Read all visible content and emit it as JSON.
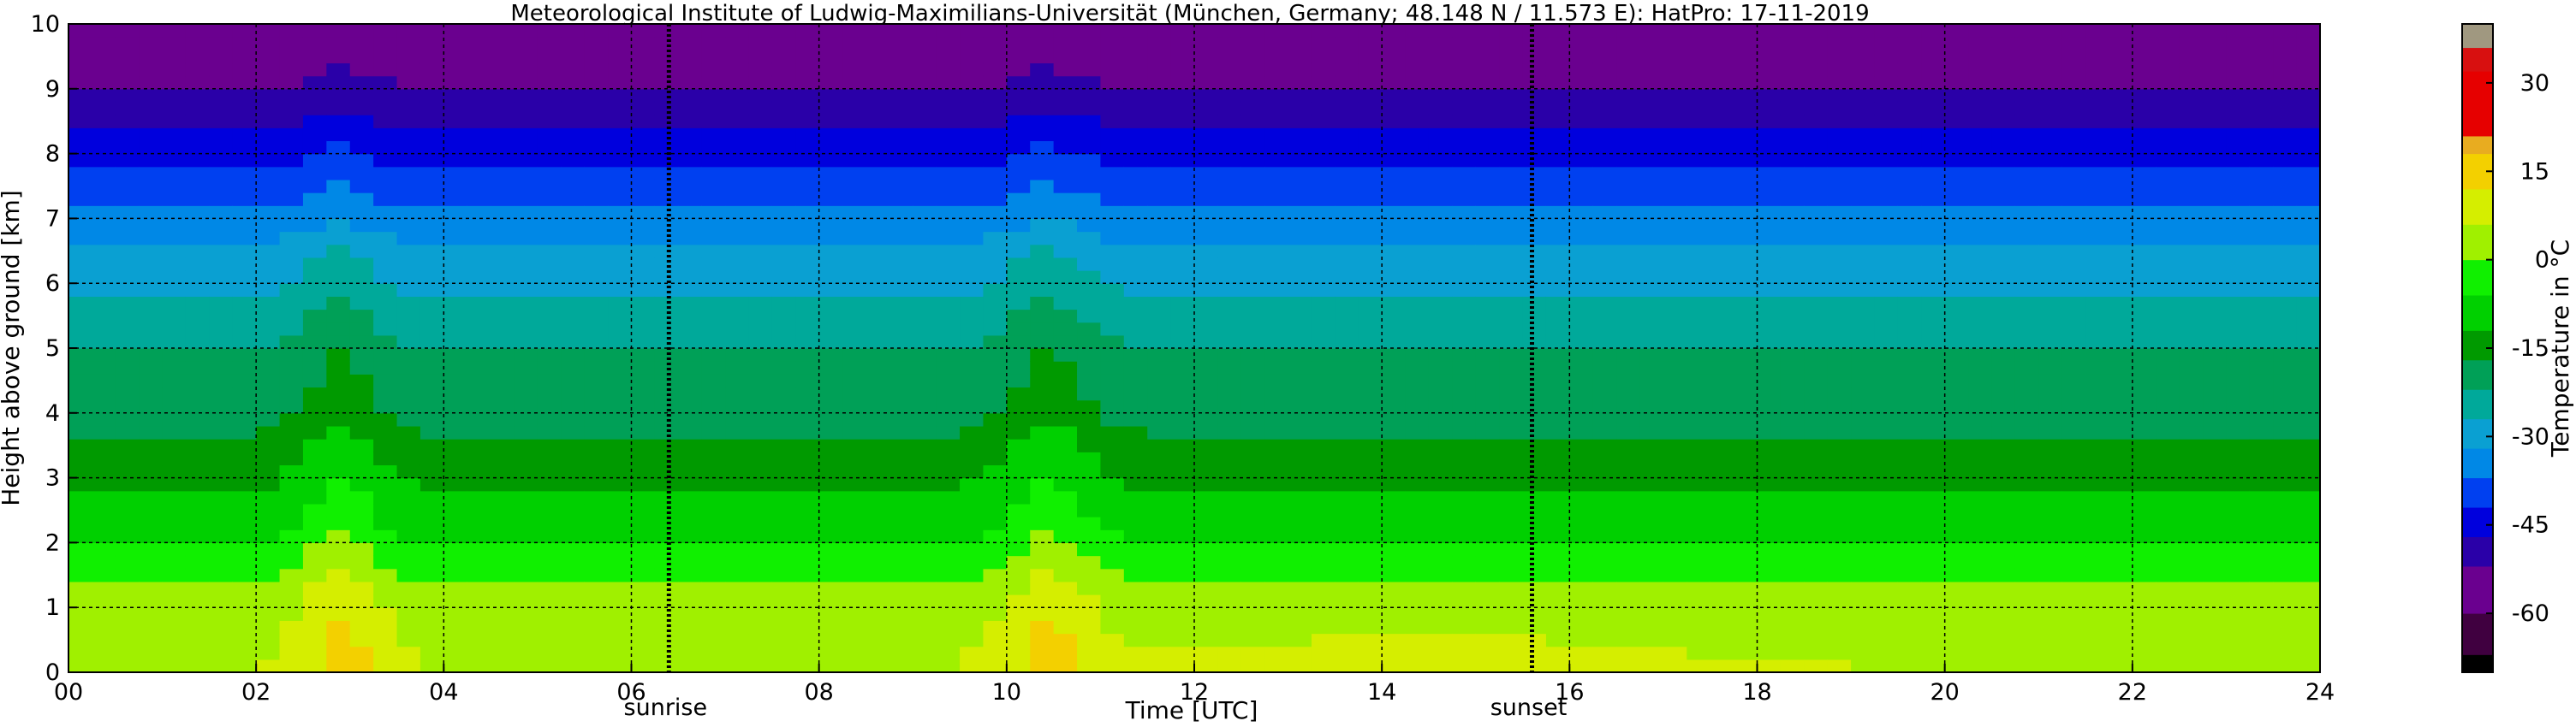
{
  "chart_data": {
    "type": "heatmap",
    "title": "Meteorological Institute of Ludwig-Maximilians-Universität (München, Germany; 48.148 N / 11.573 E):    HatPro: 17-11-2019",
    "xlabel": "Time [UTC]",
    "ylabel": "Height above ground [km]",
    "colorbar_label": "Temperature in °C",
    "xlim": [
      0,
      24
    ],
    "ylim": [
      0,
      10
    ],
    "xticks": [
      "00",
      "02",
      "04",
      "06",
      "08",
      "10",
      "12",
      "14",
      "16",
      "18",
      "20",
      "22",
      "24"
    ],
    "yticks": [
      "0",
      "1",
      "2",
      "3",
      "4",
      "5",
      "6",
      "7",
      "8",
      "9",
      "10"
    ],
    "colorbar_ticks": [
      30,
      15,
      0,
      -15,
      -30,
      -45,
      -60
    ],
    "colorbar_range": [
      -70,
      40
    ],
    "grid": true,
    "annotations": [
      {
        "label": "sunrise",
        "x": 6.4
      },
      {
        "label": "sunset",
        "x": 15.6
      }
    ],
    "colormap": [
      [
        -70,
        "#000000"
      ],
      [
        -67,
        "#400040"
      ],
      [
        -60,
        "#6a008f"
      ],
      [
        -52,
        "#2a00a8"
      ],
      [
        -47,
        "#0000dd"
      ],
      [
        -42,
        "#0040f0"
      ],
      [
        -37,
        "#0088e6"
      ],
      [
        -32,
        "#0aa0d2"
      ],
      [
        -27,
        "#00a99a"
      ],
      [
        -22,
        "#00a057"
      ],
      [
        -17,
        "#009a00"
      ],
      [
        -12,
        "#00d000"
      ],
      [
        -6,
        "#10f000"
      ],
      [
        0,
        "#a0f000"
      ],
      [
        6,
        "#d5ee00"
      ],
      [
        12,
        "#f3d000"
      ],
      [
        18,
        "#e8ac20"
      ],
      [
        21,
        "#e60000"
      ],
      [
        32,
        "#d81010"
      ],
      [
        36,
        "#a09880"
      ],
      [
        40,
        "#c8c8b4"
      ]
    ],
    "temperature_profile": {
      "description_units": "°C at height in km",
      "heights_km": [
        0,
        0.5,
        1,
        1.5,
        2,
        2.5,
        3,
        3.5,
        4,
        4.5,
        5,
        5.5,
        6,
        6.5,
        7,
        7.5,
        8,
        8.5,
        9,
        9.5,
        10
      ],
      "temperature_c": [
        6,
        5,
        3,
        -1,
        -6,
        -10,
        -13,
        -16,
        -19,
        -21,
        -22,
        -25,
        -28,
        -31,
        -36,
        -40,
        -44,
        -48,
        -52,
        -55,
        -59
      ]
    },
    "warm_plumes": [
      {
        "center_x": 2.9,
        "half_width": 0.45,
        "peak_warming_c": 9
      },
      {
        "center_x": 10.45,
        "half_width": 0.5,
        "peak_warming_c": 9
      }
    ]
  }
}
